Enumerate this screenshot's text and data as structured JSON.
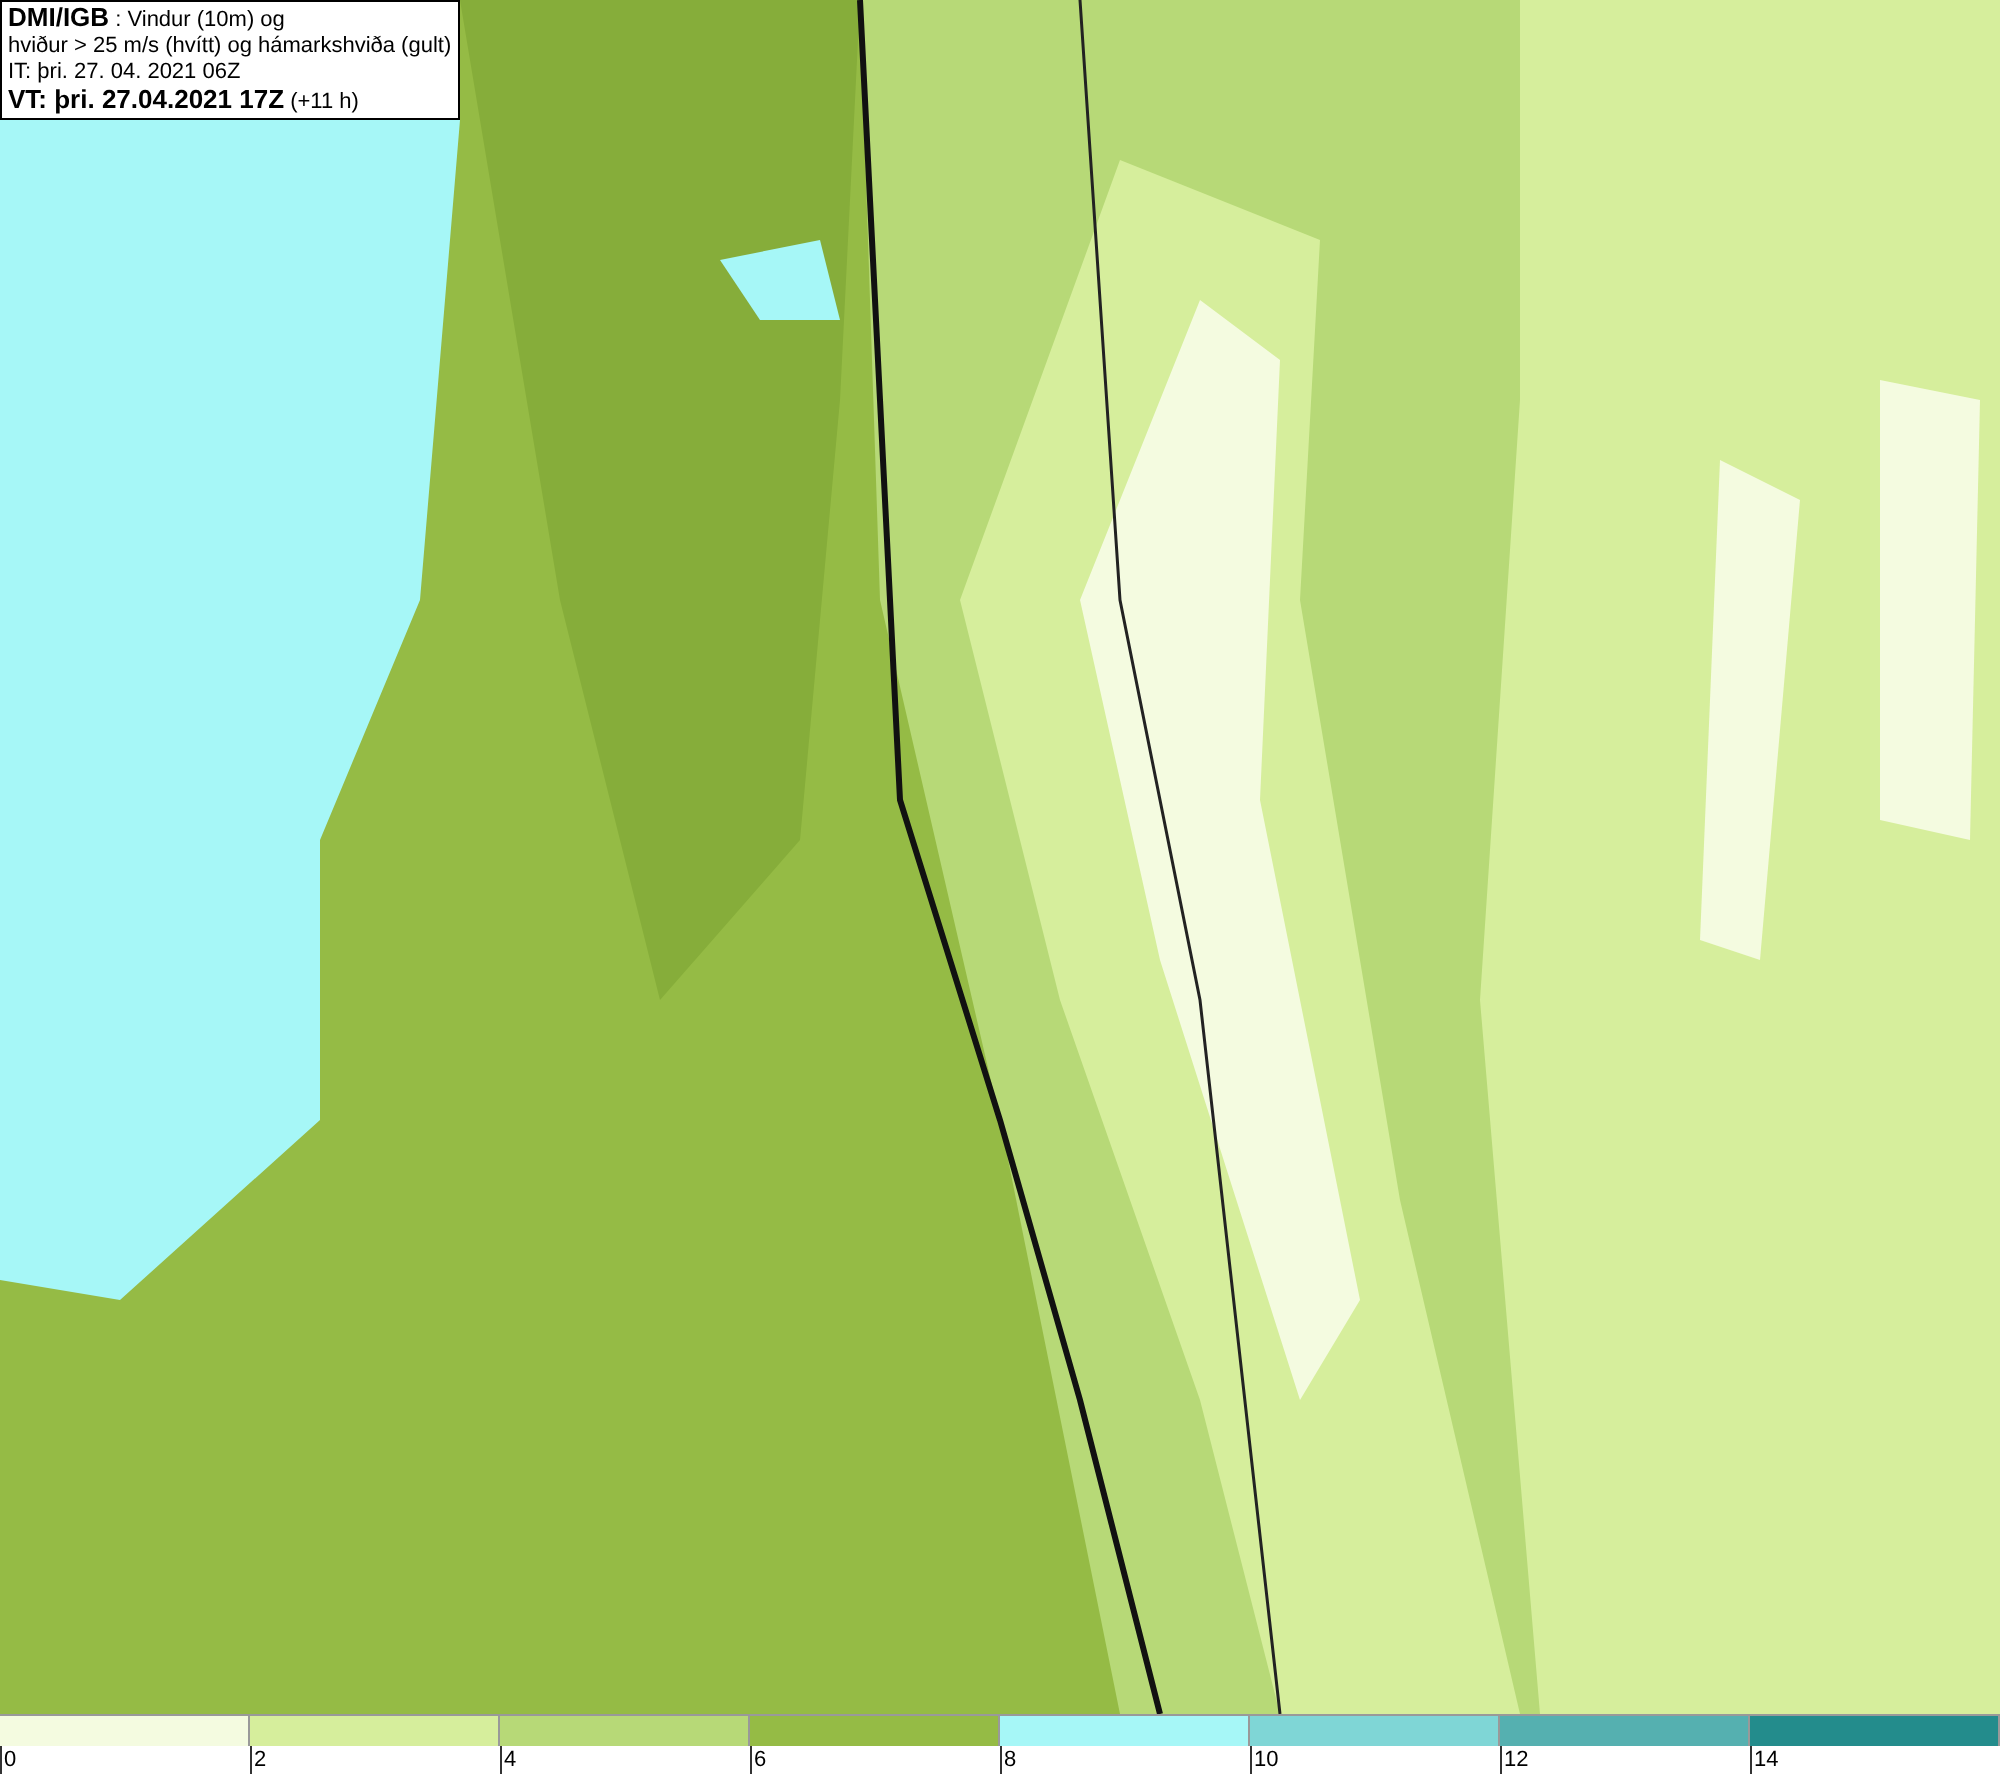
{
  "header": {
    "lines": [
      {
        "bold": "DMI/IGB",
        "rest": " : Vindur (10m) og"
      },
      {
        "rest": "hviður > 25 m/s (hvítt) og hámarkshviða (gult)"
      },
      {
        "rest": "IT: þri. 27. 04. 2021 06Z"
      },
      {
        "bold": "VT: þri. 27.04.2021 17Z",
        "rest": " (+11 h)"
      }
    ]
  },
  "legend": {
    "segments": [
      {
        "color": "#f4fbe0"
      },
      {
        "color": "#d6ee9c"
      },
      {
        "color": "#b7d977"
      },
      {
        "color": "#95bb45"
      },
      {
        "color": "#a6f7f7"
      },
      {
        "color": "#7fd6d6"
      },
      {
        "color": "#55b0b0"
      },
      {
        "color": "#238c8c"
      }
    ],
    "ticks": [
      "0",
      "2",
      "4",
      "6",
      "8",
      "10",
      "12",
      "14"
    ]
  }
}
